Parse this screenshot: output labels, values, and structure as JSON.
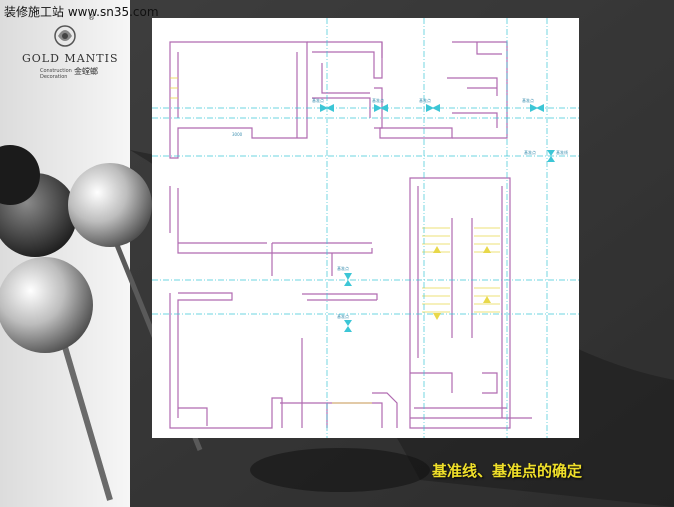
{
  "watermark": "装修施工站 www.sn35.com",
  "logo": {
    "brand": "GOLD MANTIS",
    "chinese": "金螳螂",
    "sub_line1": "Construction",
    "sub_line2": "Decoration",
    "registered": "®"
  },
  "plan": {
    "dim_label": "3000",
    "point_label": "基准点",
    "right_label": "基准线"
  },
  "caption": "基准线、基准点的确定"
}
